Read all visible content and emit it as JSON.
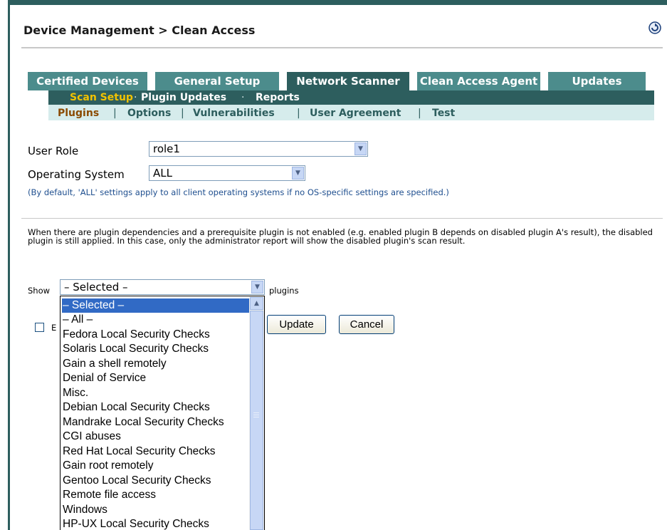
{
  "header": {
    "title": "Device Management > Clean Access",
    "refresh_icon": "refresh-icon"
  },
  "tabs": [
    {
      "label": "Certified Devices",
      "active": false
    },
    {
      "label": "General Setup",
      "active": false
    },
    {
      "label": "Network Scanner",
      "active": true
    },
    {
      "label": "Clean Access Agent",
      "active": false
    },
    {
      "label": "Updates",
      "active": false
    }
  ],
  "subnav": [
    {
      "label": "Scan Setup",
      "active": true
    },
    {
      "label": "Plugin Updates",
      "active": false
    },
    {
      "label": "Reports",
      "active": false
    }
  ],
  "subnav_separator": "·",
  "subsubnav": [
    {
      "label": "Plugins",
      "active": true
    },
    {
      "label": "Options",
      "active": false
    },
    {
      "label": "Vulnerabilities",
      "active": false
    },
    {
      "label": "User Agreement",
      "active": false
    },
    {
      "label": "Test",
      "active": false
    }
  ],
  "subsubnav_separator": "|",
  "form": {
    "user_role_label": "User Role",
    "user_role_value": "role1",
    "os_label": "Operating System",
    "os_value": "ALL",
    "hint": "(By default, 'ALL' settings apply to all client operating systems if no OS-specific settings are specified.)",
    "note": "When there are plugin dependencies and a prerequisite plugin is not enabled (e.g. enabled plugin B depends on disabled plugin A's result), the disabled plugin is still applied. In this case, only the administrator report will show the disabled plugin's scan result.",
    "show_label": "Show",
    "show_value": "– Selected –",
    "plugins_label": "plugins",
    "checkbox_label": "E",
    "update_label": "Update",
    "cancel_label": "Cancel"
  },
  "dropdown_options": [
    "– Selected –",
    "– All –",
    "Fedora Local Security Checks",
    "Solaris Local Security Checks",
    "Gain a shell remotely",
    "Denial of Service",
    "Misc.",
    "Debian Local Security Checks",
    "Mandrake Local Security Checks",
    "CGI abuses",
    "Red Hat Local Security Checks",
    "Gain root remotely",
    "Gentoo Local Security Checks",
    "Remote file access",
    "Windows",
    "HP-UX Local Security Checks"
  ],
  "dropdown_selected_index": 0,
  "colors": {
    "tab": "#4c8c8c",
    "tab_active": "#2d5e5e",
    "subnav_active": "#f2c200",
    "selection": "#316ac5",
    "hint_text": "#1f4f8f"
  }
}
